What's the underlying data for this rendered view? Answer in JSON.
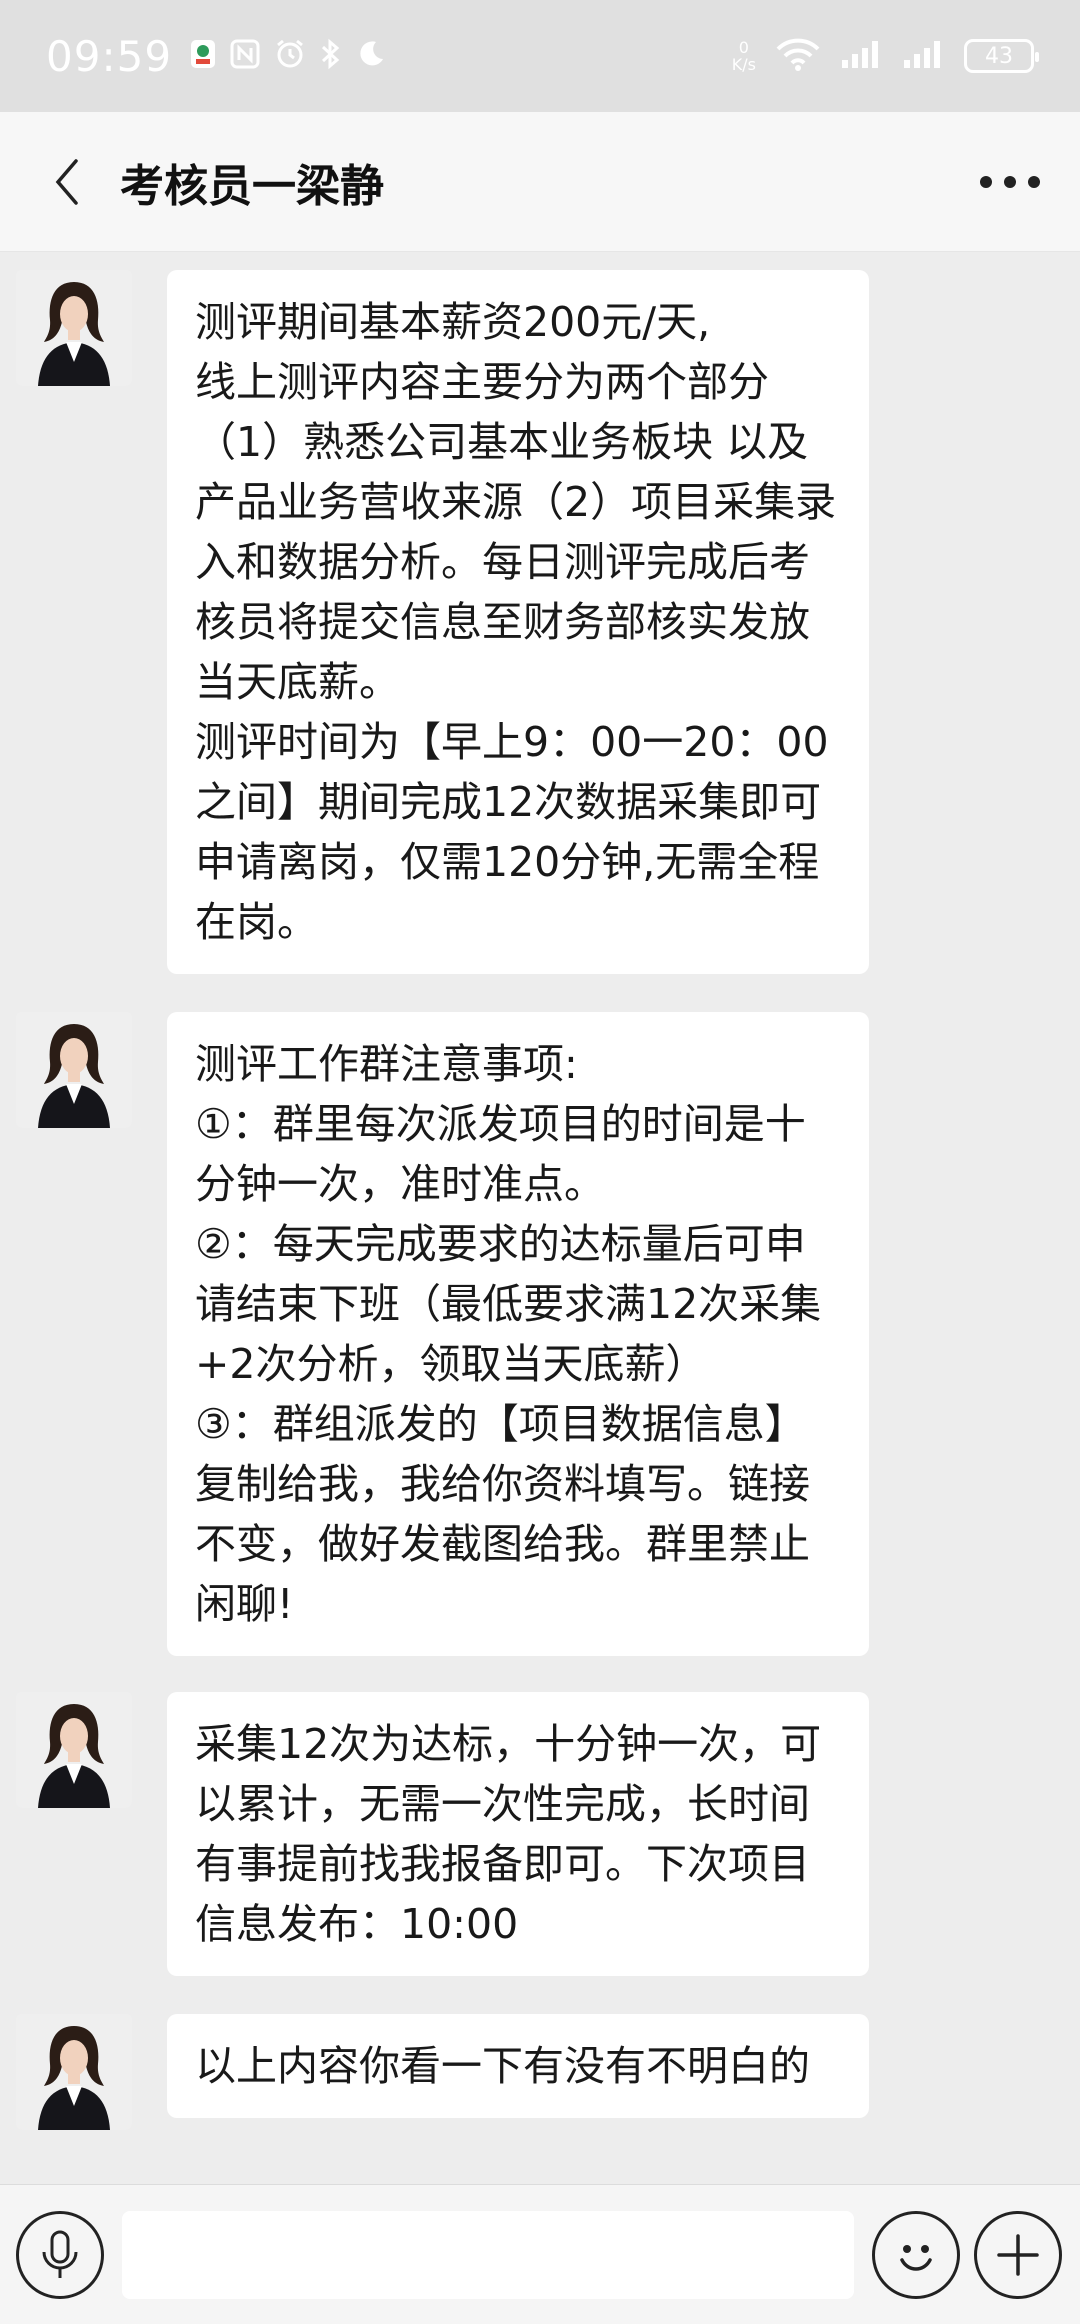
{
  "status_bar": {
    "time": "09:59",
    "net_speed_value": "0",
    "net_speed_unit": "K/s",
    "battery": "43",
    "icons": [
      "app-icon",
      "nfc-icon",
      "alarm-icon",
      "bluetooth-icon",
      "moon-icon",
      "wifi-icon",
      "signal-icon",
      "signal-icon"
    ]
  },
  "header": {
    "title": "考核员一梁静",
    "icons": [
      "back-icon",
      "more-icon"
    ]
  },
  "messages": [
    {
      "text": "测评期间基本薪资200元/天,\n线上测评内容主要分为两个部分（1）熟悉公司基本业务板块 以及产品业务营收来源（2）项目采集录入和数据分析。每日测评完成后考核员将提交信息至财务部核实发放当天底薪。\n测评时间为【早上9：00一20：00之间】期间完成12次数据采集即可申请离岗，仅需120分钟,无需全程在岗。"
    },
    {
      "text": "测评工作群注意事项:\n①：群里每次派发项目的时间是十分钟一次，准时准点。\n②：每天完成要求的达标量后可申请结束下班（最低要求满12次采集+2次分析，领取当天底薪）\n③：群组派发的【项目数据信息】复制给我，我给你资料填写。链接不变，做好发截图给我。群里禁止闲聊!"
    },
    {
      "text": "采集12次为达标，十分钟一次，可以累计，无需一次性完成，长时间有事提前找我报备即可。下次项目信息发布：10:00"
    },
    {
      "text": "以上内容你看一下有没有不明白的"
    }
  ],
  "input_bar": {
    "placeholder": "",
    "icons": [
      "microphone-icon",
      "emoji-icon",
      "plus-icon"
    ]
  },
  "colors": {
    "background": "#ededed",
    "bubble": "#ffffff",
    "header": "#f7f7f7",
    "status_bar": "#e0e0e0"
  }
}
